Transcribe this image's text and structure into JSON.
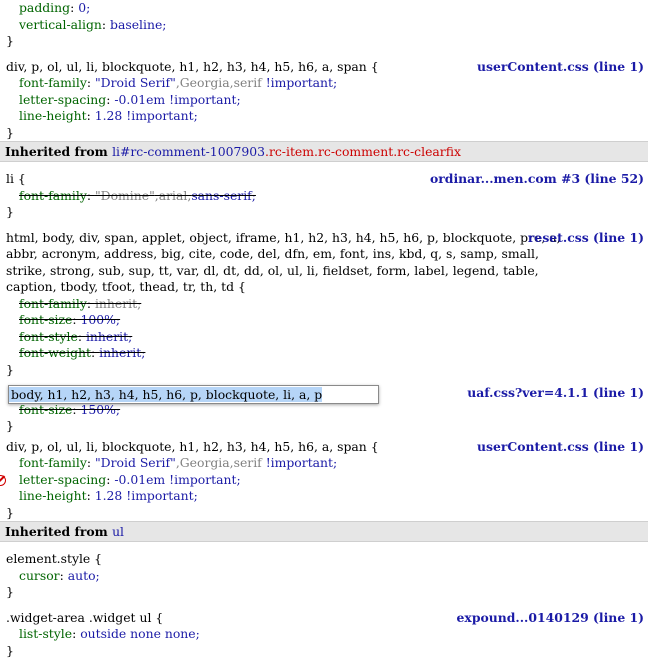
{
  "r0": {
    "props": [
      {
        "name": "padding",
        "value": "0;"
      },
      {
        "name": "vertical-align",
        "value": "baseline;"
      }
    ],
    "close": "}"
  },
  "r1": {
    "selector": "div, p, ol, ul, li, blockquote, h1, h2, h3, h4, h5, h6, a, span {",
    "source": "userContent.css (line 1)",
    "p1": {
      "name": "font-family",
      "v1": "\"Droid Serif\"",
      "v2": ",Georgia,serif",
      "v3": " !important;"
    },
    "p2": {
      "name": "letter-spacing",
      "value": "-0.01em !important;"
    },
    "p3": {
      "name": "line-height",
      "value": "1.28 !important;"
    },
    "close": "}"
  },
  "inh1": {
    "label": "Inherited from",
    "link": "li#rc-comment-1007903",
    ".cls": "",
    "cls": ".rc-item.rc-comment.rc-clearfix"
  },
  "r2": {
    "selector": "li {",
    "source": "ordinar...men.com #3 (line 52)",
    "p1": {
      "name": "font-family",
      "v1": "\"Domine\"",
      "v2": ",arial,",
      "v3": "sans-serif;"
    },
    "close": "}"
  },
  "r3": {
    "sel1": "html, body, div, span, applet, object, iframe, h1, h2, h3, h4, h5, h6, p, blockquote, pre, a,",
    "sel2": "abbr, acronym, address, big, cite, code, del, dfn, em, font, ins, kbd, q, s, samp, small,",
    "sel3": "strike, strong, sub, sup, tt, var, dl, dt, dd, ol, ul, li, fieldset, form, label, legend, table,",
    "sel4": "caption, tbody, tfoot, thead, tr, th, td {",
    "source": "reset.css (line 1)",
    "props": [
      {
        "name": "font-family",
        "value": "inherit;"
      },
      {
        "name": "font-size",
        "value": "100%;"
      },
      {
        "name": "font-style",
        "value": "inherit;"
      },
      {
        "name": "font-weight",
        "value": "inherit;"
      }
    ],
    "close": "}"
  },
  "r4": {
    "editing": "body, h1, h2, h3, h4, h5, h6, p, blockquote, li, a, p",
    "source": "uaf.css?ver=4.1.1 (line 1)",
    "p1": {
      "name": "font-size",
      "value": "150%;"
    },
    "close": "}"
  },
  "r5": {
    "selector": "div, p, ol, ul, li, blockquote, h1, h2, h3, h4, h5, h6, a, span {",
    "source": "userContent.css (line 1)",
    "p1": {
      "name": "font-family",
      "v1": "\"Droid Serif\"",
      "v2": ",Georgia,serif",
      "v3": " !important;"
    },
    "p2": {
      "name": "letter-spacing",
      "value": "-0.01em !important;"
    },
    "p3": {
      "name": "line-height",
      "value": "1.28 !important;"
    },
    "close": "}"
  },
  "inh2": {
    "label": "Inherited from",
    "link": "ul"
  },
  "r6": {
    "selector": "element.style {",
    "p1": {
      "name": "cursor",
      "value": "auto;"
    },
    "close": "}"
  },
  "r7": {
    "selector": ".widget-area .widget ul {",
    "source": "expound...0140129 (line 1)",
    "p1": {
      "name": "list-style",
      "value": "outside none none;"
    },
    "close": "}"
  }
}
